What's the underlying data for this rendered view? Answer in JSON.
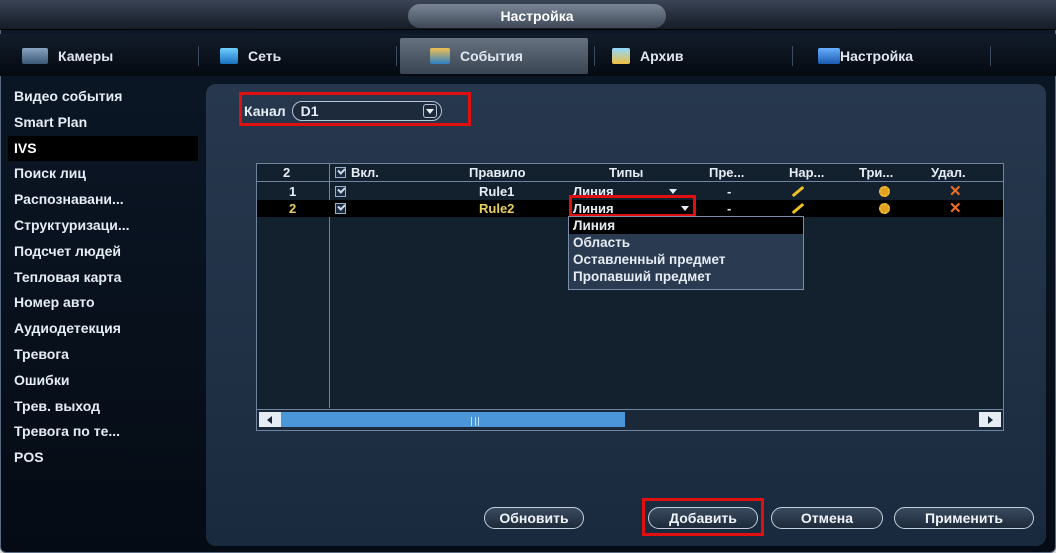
{
  "window": {
    "title": "Настройка"
  },
  "tabs": [
    {
      "label": "Камеры",
      "icon": "camera-icon",
      "active": false
    },
    {
      "label": "Сеть",
      "icon": "network-icon",
      "active": false
    },
    {
      "label": "События",
      "icon": "events-icon",
      "active": true
    },
    {
      "label": "Архив",
      "icon": "archive-icon",
      "active": false
    },
    {
      "label": "Настройка",
      "icon": "settings-icon",
      "active": false
    }
  ],
  "sidebar": {
    "items": [
      {
        "label": "Видео события"
      },
      {
        "label": "Smart Plan"
      },
      {
        "label": "IVS",
        "active": true
      },
      {
        "label": "Поиск лиц"
      },
      {
        "label": "Распознавани..."
      },
      {
        "label": "Структуризаци..."
      },
      {
        "label": "Подсчет людей"
      },
      {
        "label": "Тепловая карта"
      },
      {
        "label": "Номер авто"
      },
      {
        "label": "Аудиодетекция"
      },
      {
        "label": "Тревога"
      },
      {
        "label": "Ошибки"
      },
      {
        "label": "Трев. выход"
      },
      {
        "label": "Тревога по те..."
      },
      {
        "label": "POS"
      }
    ]
  },
  "channel": {
    "label": "Канал",
    "value": "D1"
  },
  "table": {
    "headers": {
      "count": "2",
      "enabled": "Вкл.",
      "rule": "Правило",
      "type": "Типы",
      "preset": "Пре...",
      "draw": "Нар...",
      "trigger": "Три...",
      "delete": "Удал."
    },
    "rows": [
      {
        "num": "1",
        "rule": "Rule1",
        "type": "Линия",
        "preset": "-"
      },
      {
        "num": "2",
        "rule": "Rule2",
        "type": "Линия",
        "preset": "-"
      }
    ]
  },
  "dropdown": {
    "options": [
      "Линия",
      "Область",
      "Оставленный предмет",
      "Пропавший предмет"
    ]
  },
  "buttons": {
    "refresh": "Обновить",
    "add": "Добавить",
    "cancel": "Отмена",
    "apply": "Применить"
  },
  "colors": {
    "accent": "#4a96d8",
    "highlight_border": "#e01010",
    "selected_text": "#e8d060"
  }
}
